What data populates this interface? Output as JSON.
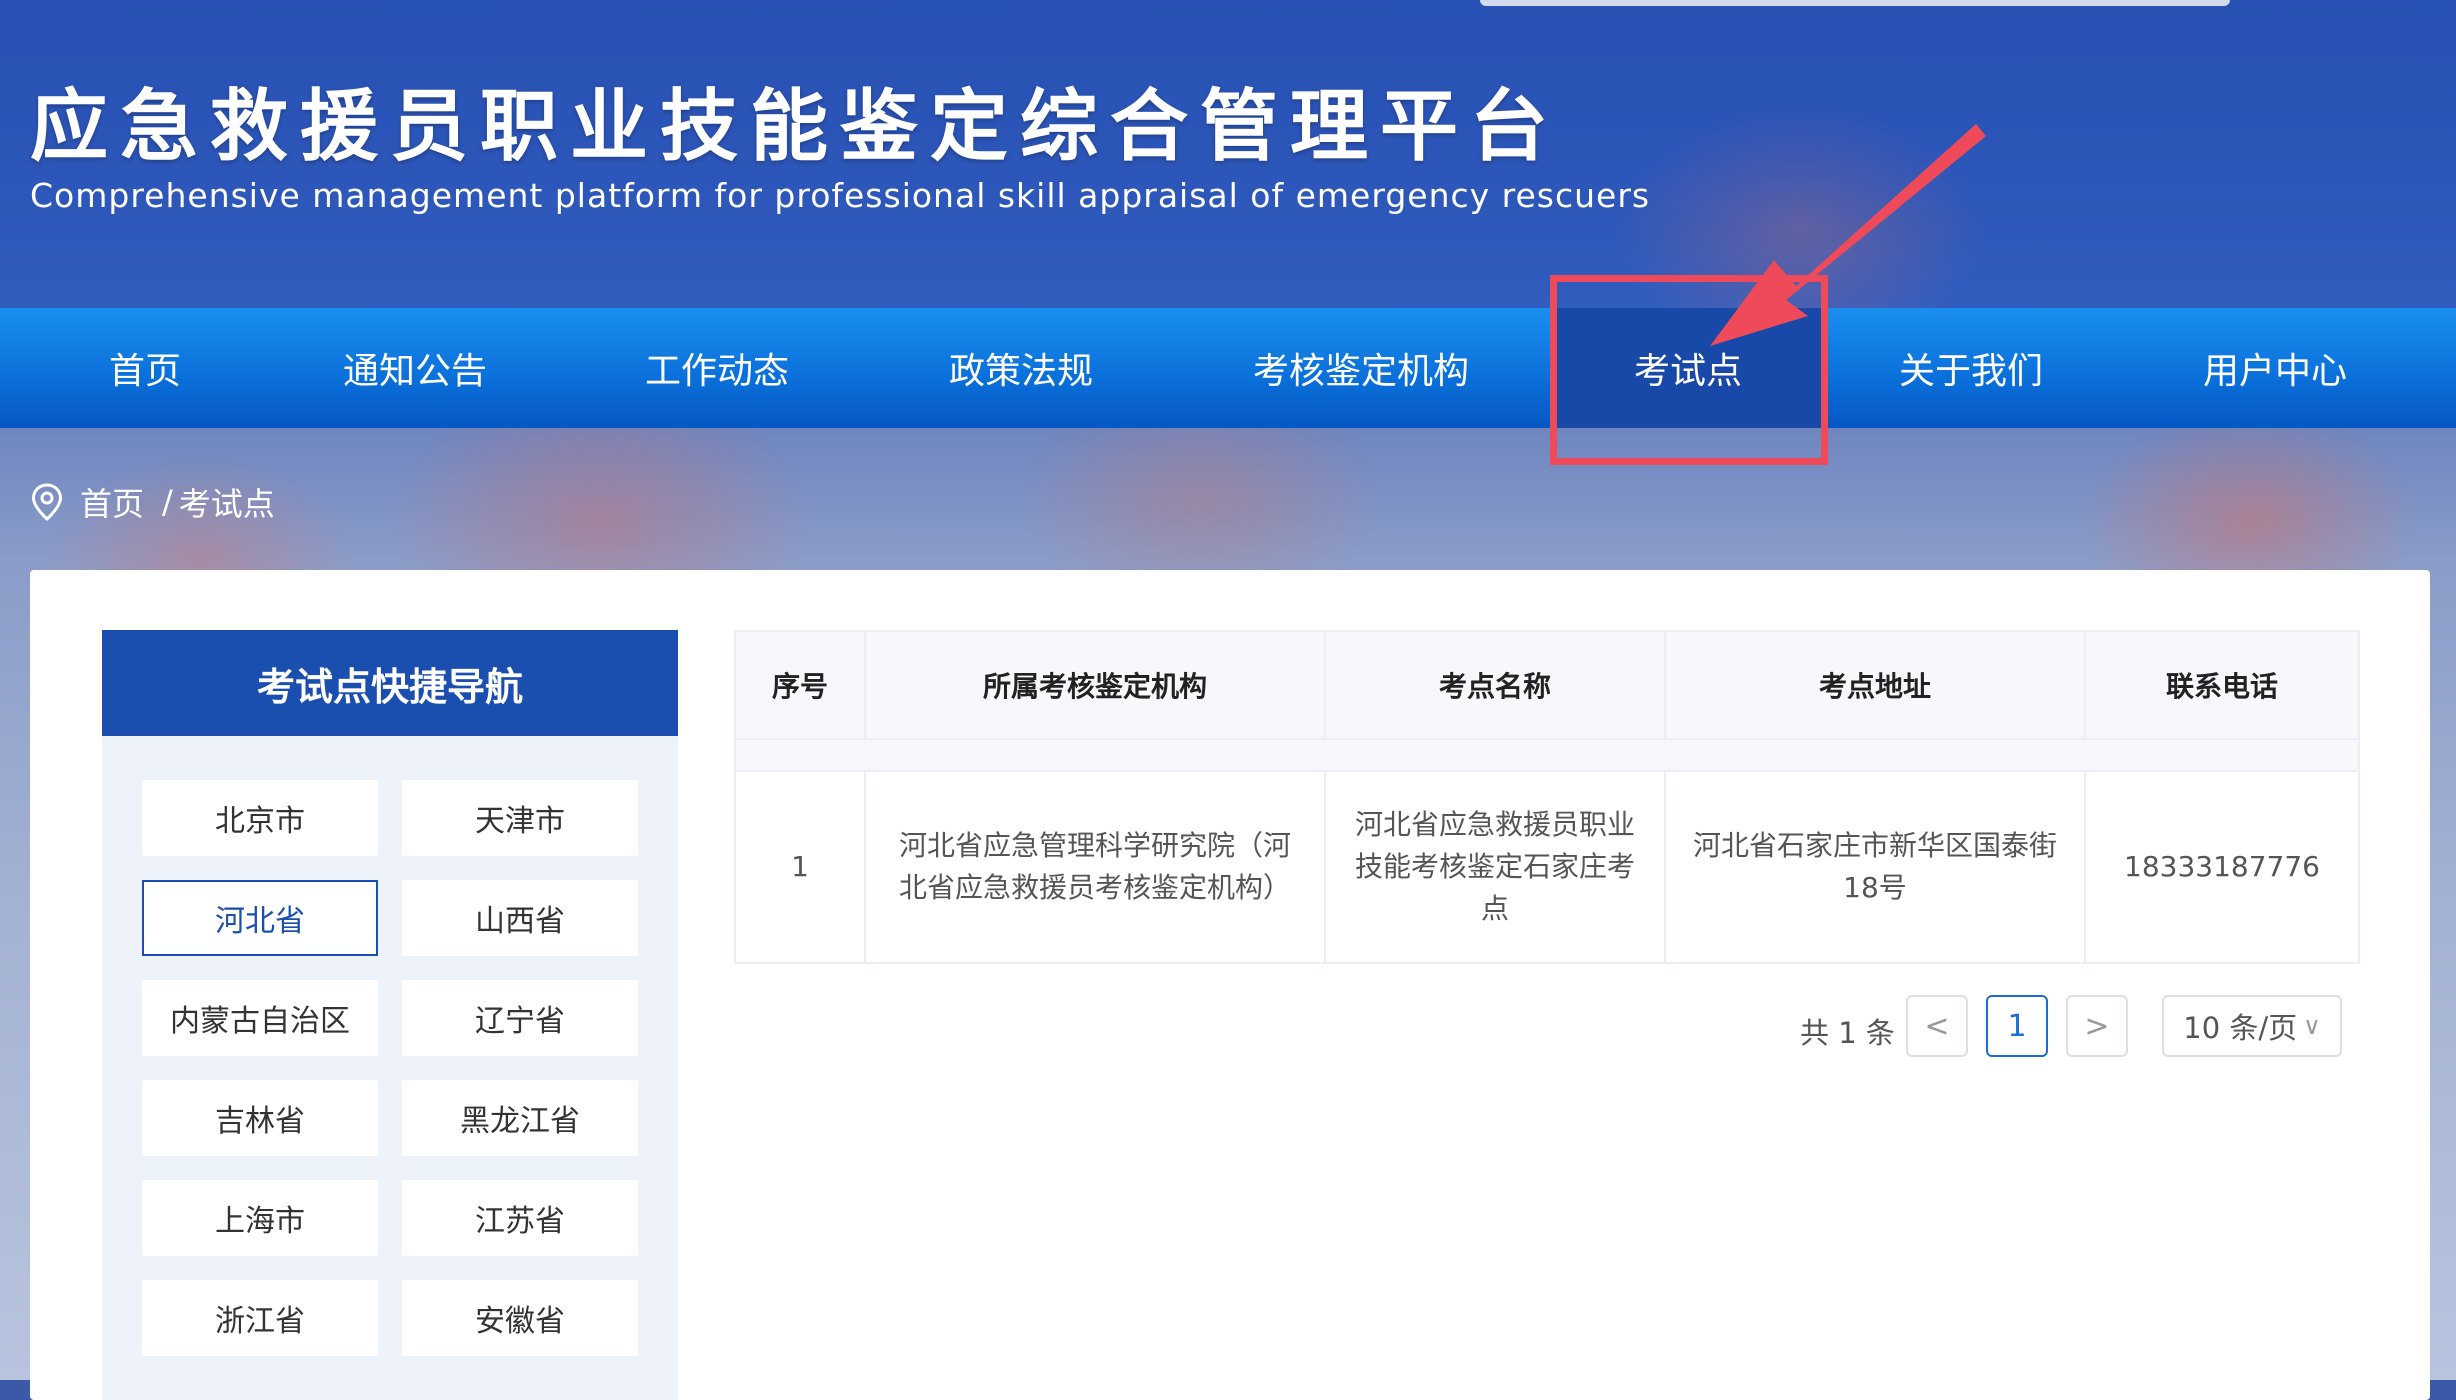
{
  "header": {
    "title": "应急救援员职业技能鉴定综合管理平台",
    "subtitle": "Comprehensive management platform for professional skill appraisal of emergency rescuers"
  },
  "nav": {
    "items": [
      {
        "label": "首页"
      },
      {
        "label": "通知公告"
      },
      {
        "label": "工作动态"
      },
      {
        "label": "政策法规"
      },
      {
        "label": "考核鉴定机构"
      },
      {
        "label": "考试点"
      },
      {
        "label": "关于我们"
      },
      {
        "label": "用户中心"
      }
    ],
    "active": "考试点"
  },
  "breadcrumb": {
    "home": "首页",
    "separator": "/",
    "current": "考试点"
  },
  "quicknav": {
    "title": "考试点快捷导航",
    "selected": "河北省",
    "provinces": [
      "北京市",
      "天津市",
      "河北省",
      "山西省",
      "内蒙古自治区",
      "辽宁省",
      "吉林省",
      "黑龙江省",
      "上海市",
      "江苏省",
      "浙江省",
      "安徽省"
    ]
  },
  "table": {
    "columns": [
      "序号",
      "所属考核鉴定机构",
      "考点名称",
      "考点地址",
      "联系电话"
    ],
    "rows": [
      {
        "index": "1",
        "org": "河北省应急管理科学研究院（河北省应急救援员考核鉴定机构）",
        "name": "河北省应急救援员职业技能考核鉴定石家庄考点",
        "address": "河北省石家庄市新华区国泰街18号",
        "phone": "18333187776"
      }
    ]
  },
  "pagination": {
    "total": "共 1 条",
    "prev": "<",
    "current_page": "1",
    "next": ">",
    "page_size": "10 条/页",
    "page_size_chevron": "∨"
  },
  "colors": {
    "nav_bg": "#0a6fd9",
    "nav_active": "#1848a8",
    "accent": "#1a4fb0",
    "annotation_red": "#ee4a5a"
  }
}
